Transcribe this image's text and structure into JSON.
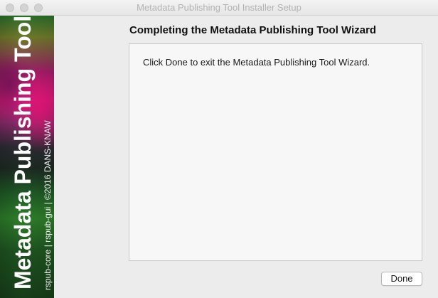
{
  "window": {
    "title": "Metadata Publishing Tool Installer Setup",
    "controls": [
      "close-button",
      "minimize-button",
      "zoom-button"
    ]
  },
  "sidebar": {
    "title": "Metadata Publishing Tool",
    "credit": "rspub-core | rspub-gui | ©2016 DANS-KNAW"
  },
  "page": {
    "title": "Completing the Metadata Publishing Tool Wizard",
    "message": "Click Done to exit the Metadata Publishing Tool Wizard."
  },
  "buttons": {
    "done_label": "Done"
  }
}
